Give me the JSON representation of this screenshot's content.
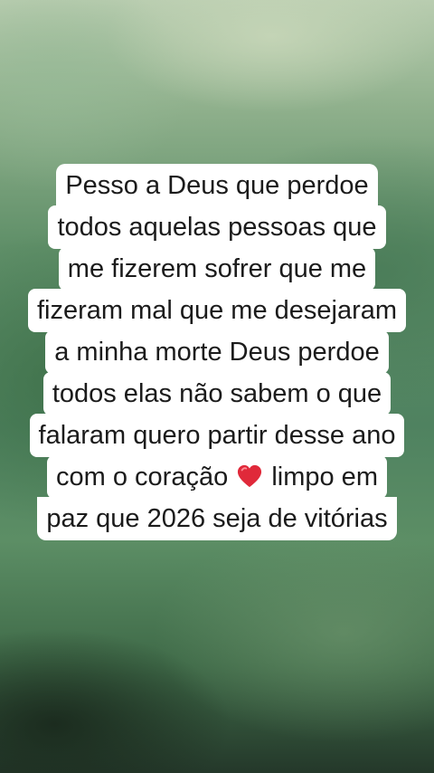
{
  "caption": {
    "lines": [
      "Pesso a Deus que  perdoe",
      "todos aquelas pessoas que",
      "me fizerem sofrer que me",
      "fizeram mal que me desejaram",
      "a minha morte Deus perdoe",
      "todos elas não sabem o que",
      "falaram quero partir desse ano",
      "com o  coração",
      "limpo em",
      "paz que 2026 seja de vitórias"
    ],
    "heart_icon": "red-heart-emoji"
  },
  "colors": {
    "card_background": "#ffffff",
    "text": "#1b1b1b",
    "heart": "#e0293a",
    "background_tone": "#4f8260"
  }
}
